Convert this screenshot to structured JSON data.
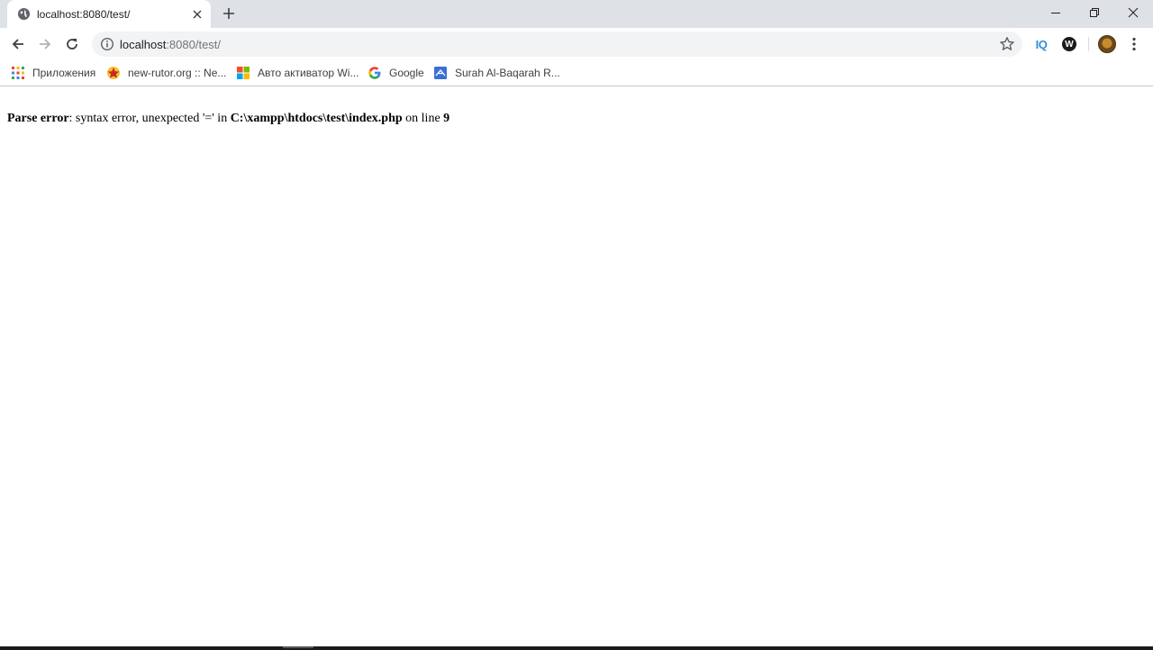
{
  "tab": {
    "title": "localhost:8080/test/",
    "favicon": "globe-icon"
  },
  "window_controls": [
    "minimize-icon",
    "restore-icon",
    "close-icon"
  ],
  "omnibox": {
    "host": "localhost",
    "rest": ":8080/test/"
  },
  "extensions": {
    "iq_label": "IQ",
    "w_label": "W"
  },
  "bookmarks": [
    {
      "label": "Приложения",
      "icon": "apps-grid-icon"
    },
    {
      "label": "new-rutor.org :: Ne...",
      "icon": "rutor-icon"
    },
    {
      "label": "Авто активатор Wi...",
      "icon": "windows-logo-icon"
    },
    {
      "label": "Google",
      "icon": "google-icon"
    },
    {
      "label": "Surah Al-Baqarah R...",
      "icon": "quran-icon"
    }
  ],
  "error": {
    "label": "Parse error",
    "message": ": syntax error, unexpected '=' in ",
    "path": "C:\\xampp\\htdocs\\test\\index.php",
    "on_line": " on line ",
    "line": "9"
  },
  "colors": {
    "tabstrip": "#dee1e6",
    "omnibox": "#f1f3f4",
    "iq_accent": "#2f8fdd"
  }
}
